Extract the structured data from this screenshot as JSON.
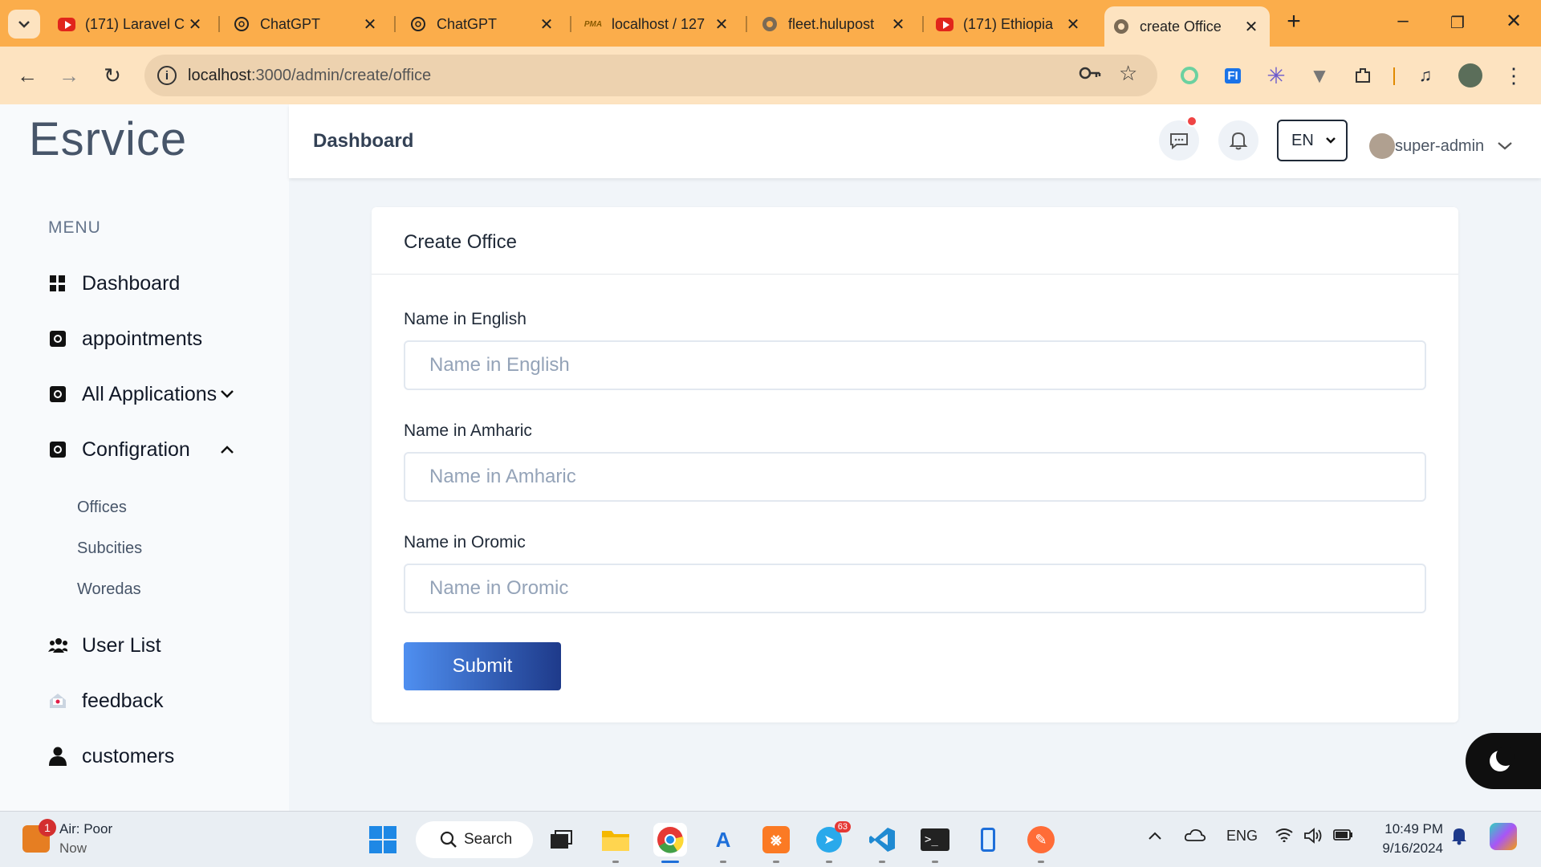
{
  "browser": {
    "tabs": [
      {
        "title": "(171) Laravel C",
        "favicon": "youtube-icon"
      },
      {
        "title": "ChatGPT",
        "favicon": "chatgpt-icon"
      },
      {
        "title": "ChatGPT",
        "favicon": "chatgpt-icon"
      },
      {
        "title": "localhost / 127",
        "favicon": "phpmyadmin-icon"
      },
      {
        "title": "fleet.hulupost",
        "favicon": "globe-icon"
      },
      {
        "title": "(171) Ethiopia",
        "favicon": "youtube-icon"
      },
      {
        "title": "create Office",
        "favicon": "globe-icon",
        "active": true
      }
    ],
    "url_host": "localhost",
    "url_path": ":3000/admin/create/office",
    "accent": "#fbad4b"
  },
  "app": {
    "logo": "Esrvice",
    "menu_label": "MENU",
    "nav": [
      {
        "label": "Dashboard"
      },
      {
        "label": "appointments"
      },
      {
        "label": "All Applications"
      },
      {
        "label": "Configration"
      },
      {
        "label": "User List"
      },
      {
        "label": "feedback"
      },
      {
        "label": "customers"
      }
    ],
    "sub_nav": [
      "Offices",
      "Subcities",
      "Woredas"
    ],
    "header_title": "Dashboard",
    "language": "EN",
    "user": "super-admin"
  },
  "form": {
    "title": "Create Office",
    "fields": [
      {
        "label": "Name in English",
        "placeholder": "Name in English"
      },
      {
        "label": "Name in Amharic",
        "placeholder": "Name in Amharic"
      },
      {
        "label": "Name in Oromic",
        "placeholder": "Name in Oromic"
      }
    ],
    "submit": "Submit"
  },
  "taskbar": {
    "weather_title": "Air: Poor",
    "weather_sub": "Now",
    "weather_badge": "1",
    "search": "Search",
    "telegram_badge": "63",
    "lang": "ENG",
    "time": "10:49 PM",
    "date": "9/16/2024"
  }
}
